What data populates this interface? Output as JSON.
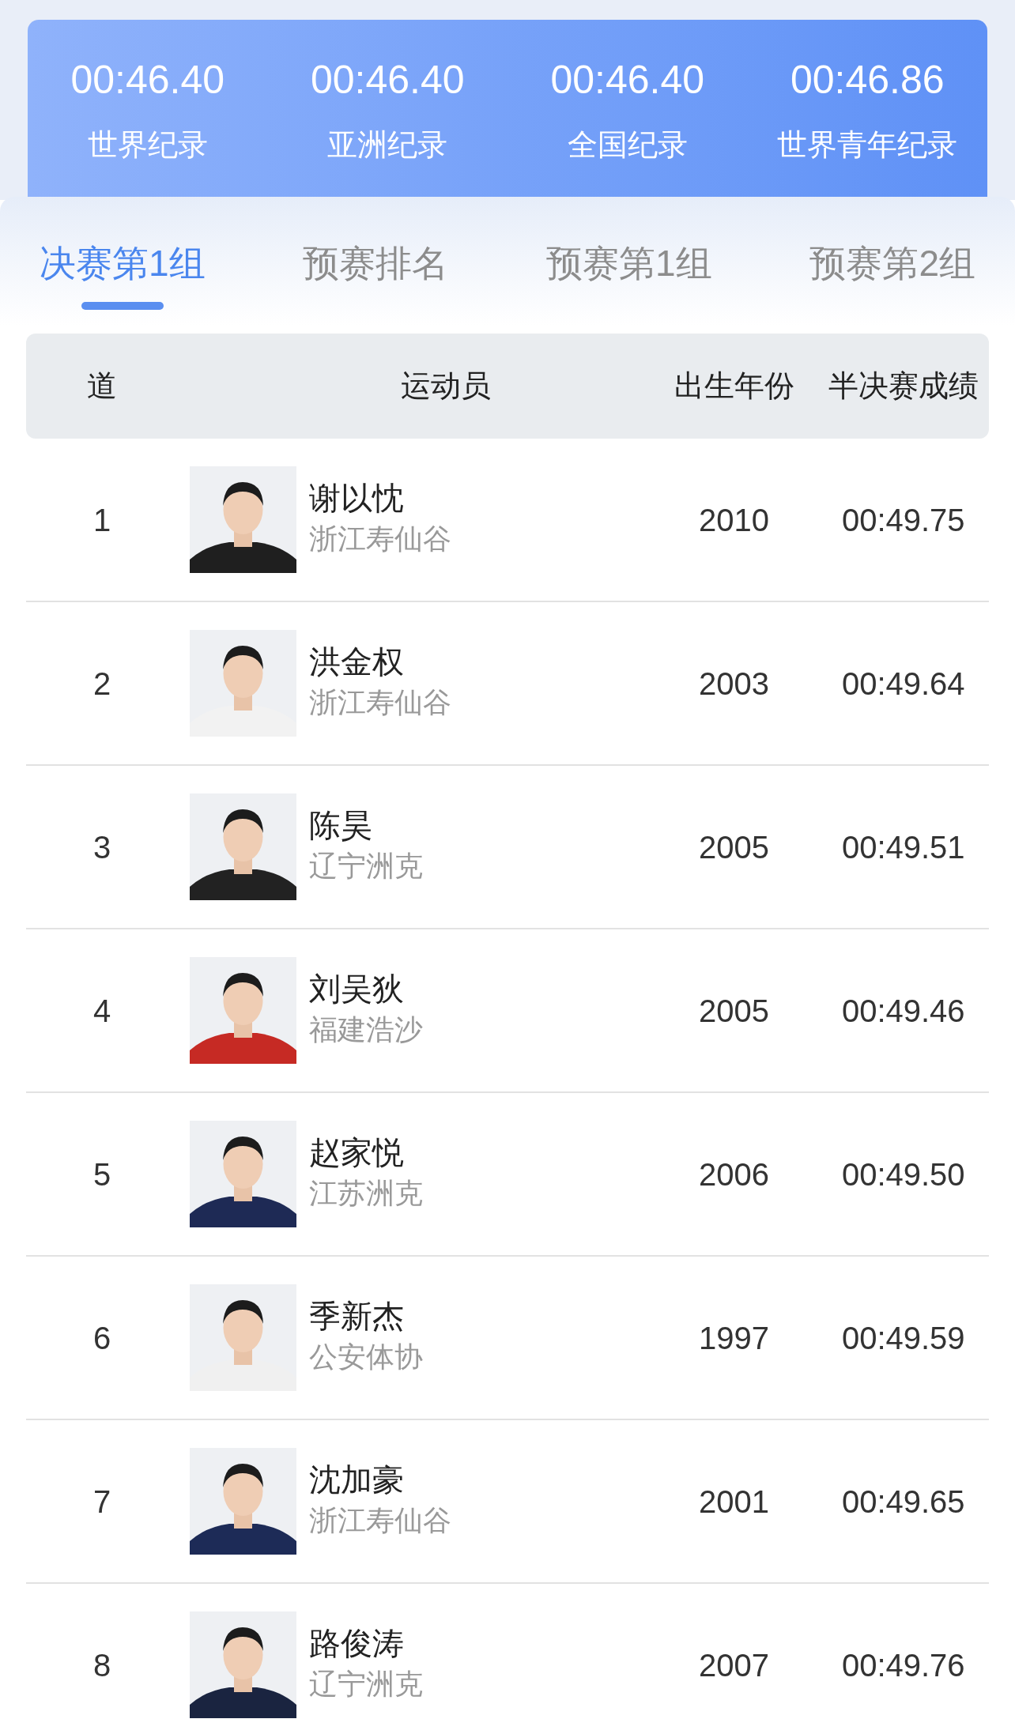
{
  "records": [
    {
      "time": "00:46.40",
      "label": "世界纪录"
    },
    {
      "time": "00:46.40",
      "label": "亚洲纪录"
    },
    {
      "time": "00:46.40",
      "label": "全国纪录"
    },
    {
      "time": "00:46.86",
      "label": "世界青年纪录"
    }
  ],
  "tabs": [
    {
      "label": "决赛第1组",
      "selected": true
    },
    {
      "label": "预赛排名",
      "selected": false
    },
    {
      "label": "预赛第1组",
      "selected": false
    },
    {
      "label": "预赛第2组",
      "selected": false
    }
  ],
  "table": {
    "columns": [
      "道",
      "运动员",
      "出生年份",
      "半决赛成绩"
    ],
    "rows": [
      {
        "lane": "1",
        "name": "谢以忱",
        "team": "浙江寿仙谷",
        "year": "2010",
        "result": "00:49.75"
      },
      {
        "lane": "2",
        "name": "洪金权",
        "team": "浙江寿仙谷",
        "year": "2003",
        "result": "00:49.64"
      },
      {
        "lane": "3",
        "name": "陈昊",
        "team": "辽宁洲克",
        "year": "2005",
        "result": "00:49.51"
      },
      {
        "lane": "4",
        "name": "刘吴狄",
        "team": "福建浩沙",
        "year": "2005",
        "result": "00:49.46"
      },
      {
        "lane": "5",
        "name": "赵家悦",
        "team": "江苏洲克",
        "year": "2006",
        "result": "00:49.50"
      },
      {
        "lane": "6",
        "name": "季新杰",
        "team": "公安体协",
        "year": "1997",
        "result": "00:49.59"
      },
      {
        "lane": "7",
        "name": "沈加豪",
        "team": "浙江寿仙谷",
        "year": "2001",
        "result": "00:49.65"
      },
      {
        "lane": "8",
        "name": "路俊涛",
        "team": "辽宁洲克",
        "year": "2007",
        "result": "00:49.76"
      }
    ]
  }
}
